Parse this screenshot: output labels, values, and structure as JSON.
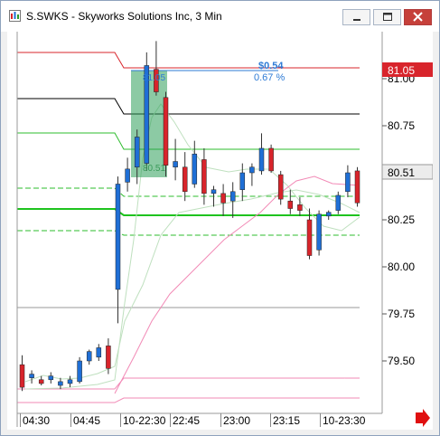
{
  "window": {
    "title": "S.SWKS - Skyworks Solutions Inc, 3 Min",
    "colors": {
      "title_close": "#c6403a",
      "frame": "#8ea2bd"
    }
  },
  "chart_data": {
    "type": "candlestick",
    "symbol": "S.SWKS",
    "ylim": [
      79.3,
      81.3
    ],
    "price_ticks": [
      "81.00",
      "80.75",
      "80.50",
      "80.25",
      "80.00",
      "79.75",
      "79.50"
    ],
    "time_ticks": [
      "04:30",
      "04:45",
      "10-22:30",
      "22:45",
      "23:00",
      "23:15",
      "10-23:30"
    ],
    "price_label_top": "81.05",
    "price_label_current": "80.51",
    "annotation_dollar": "$0.54",
    "annotation_percent": "0.67 %",
    "annotation_high": "81.05",
    "annotation_low": "80.51",
    "colors": {
      "up": "#1f6fd6",
      "down": "#d8242b",
      "accent": "#2e7bd6",
      "arrow": "#e01010"
    },
    "candles": [
      {
        "o": 79.48,
        "h": 79.53,
        "l": 79.34,
        "c": 79.36
      },
      {
        "o": 79.41,
        "h": 79.45,
        "l": 79.38,
        "c": 79.43
      },
      {
        "o": 79.4,
        "h": 79.42,
        "l": 79.37,
        "c": 79.38
      },
      {
        "o": 79.4,
        "h": 79.44,
        "l": 79.38,
        "c": 79.42
      },
      {
        "o": 79.37,
        "h": 79.41,
        "l": 79.35,
        "c": 79.39
      },
      {
        "o": 79.38,
        "h": 79.42,
        "l": 79.36,
        "c": 79.4
      },
      {
        "o": 79.39,
        "h": 79.52,
        "l": 79.38,
        "c": 79.5
      },
      {
        "o": 79.5,
        "h": 79.56,
        "l": 79.48,
        "c": 79.55
      },
      {
        "o": 79.52,
        "h": 79.59,
        "l": 79.5,
        "c": 79.57
      },
      {
        "o": 79.58,
        "h": 79.62,
        "l": 79.43,
        "c": 79.46
      },
      {
        "o": 79.88,
        "h": 80.48,
        "l": 79.7,
        "c": 80.44
      },
      {
        "o": 80.45,
        "h": 80.58,
        "l": 80.4,
        "c": 80.52
      },
      {
        "o": 80.53,
        "h": 80.73,
        "l": 80.44,
        "c": 80.69
      },
      {
        "o": 80.55,
        "h": 81.14,
        "l": 80.51,
        "c": 81.07
      },
      {
        "o": 81.05,
        "h": 81.2,
        "l": 80.91,
        "c": 80.93
      },
      {
        "o": 80.9,
        "h": 80.93,
        "l": 80.48,
        "c": 80.54
      },
      {
        "o": 80.53,
        "h": 80.68,
        "l": 80.46,
        "c": 80.56
      },
      {
        "o": 80.53,
        "h": 80.61,
        "l": 80.35,
        "c": 80.4
      },
      {
        "o": 80.44,
        "h": 80.67,
        "l": 80.42,
        "c": 80.6
      },
      {
        "o": 80.57,
        "h": 80.63,
        "l": 80.33,
        "c": 80.39
      },
      {
        "o": 80.39,
        "h": 80.43,
        "l": 80.32,
        "c": 80.41
      },
      {
        "o": 80.39,
        "h": 80.44,
        "l": 80.27,
        "c": 80.34
      },
      {
        "o": 80.35,
        "h": 80.45,
        "l": 80.26,
        "c": 80.4
      },
      {
        "o": 80.41,
        "h": 80.55,
        "l": 80.35,
        "c": 80.5
      },
      {
        "o": 80.5,
        "h": 80.55,
        "l": 80.43,
        "c": 80.53
      },
      {
        "o": 80.51,
        "h": 80.71,
        "l": 80.49,
        "c": 80.63
      },
      {
        "o": 80.63,
        "h": 80.65,
        "l": 80.5,
        "c": 80.51
      },
      {
        "o": 80.49,
        "h": 80.51,
        "l": 80.33,
        "c": 80.36
      },
      {
        "o": 80.35,
        "h": 80.41,
        "l": 80.28,
        "c": 80.31
      },
      {
        "o": 80.33,
        "h": 80.37,
        "l": 80.27,
        "c": 80.3
      },
      {
        "o": 80.25,
        "h": 80.31,
        "l": 80.04,
        "c": 80.06
      },
      {
        "o": 80.09,
        "h": 80.3,
        "l": 80.06,
        "c": 80.28
      },
      {
        "o": 80.27,
        "h": 80.3,
        "l": 80.25,
        "c": 80.29
      },
      {
        "o": 80.3,
        "h": 80.4,
        "l": 80.28,
        "c": 80.38
      },
      {
        "o": 80.4,
        "h": 80.54,
        "l": 80.37,
        "c": 80.5
      },
      {
        "o": 80.51,
        "h": 80.53,
        "l": 80.32,
        "c": 80.34
      }
    ]
  }
}
